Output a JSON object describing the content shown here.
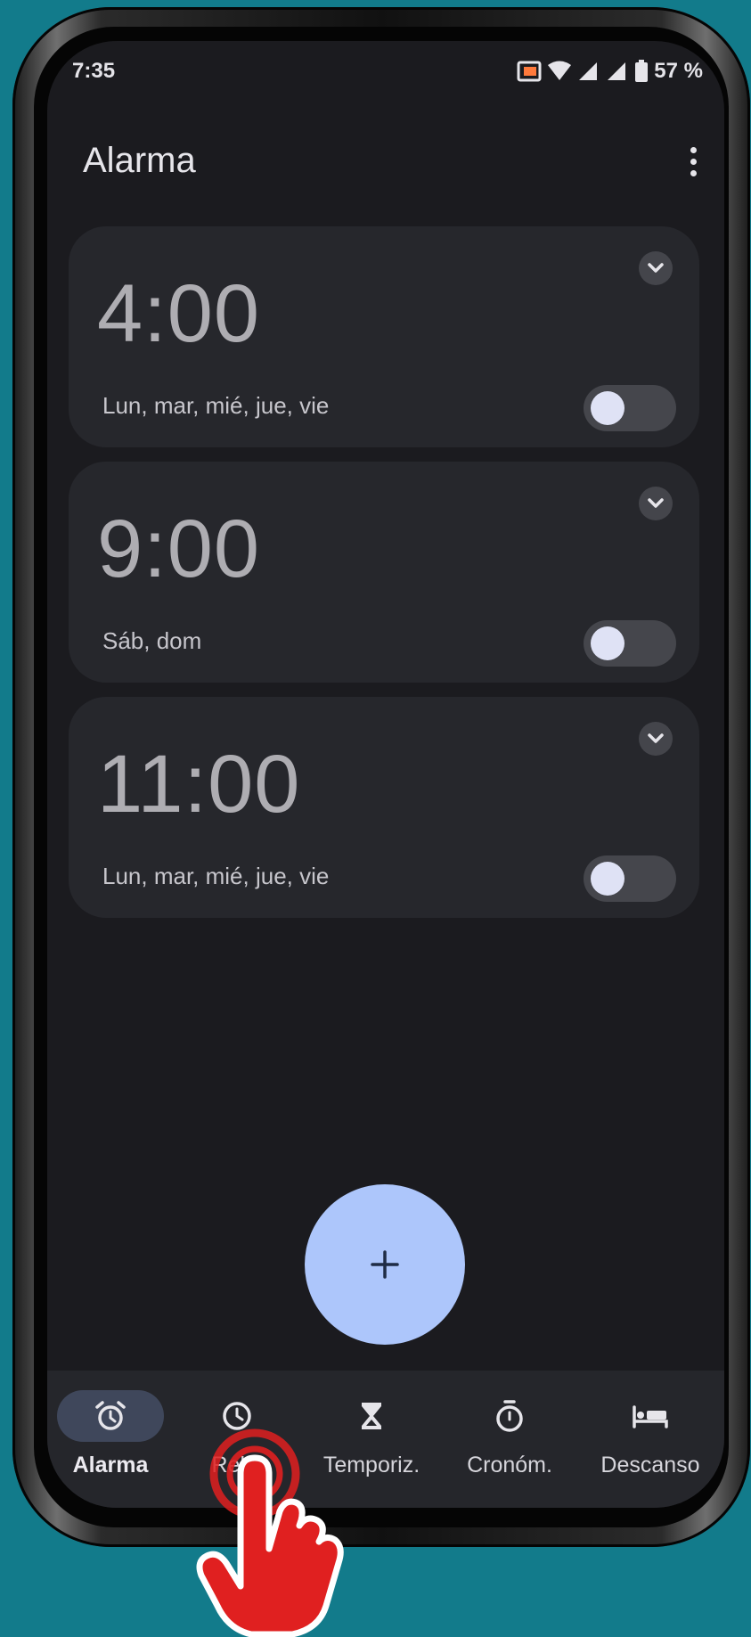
{
  "status_bar": {
    "time": "7:35",
    "battery": "57 %"
  },
  "header": {
    "title": "Alarma"
  },
  "alarms": [
    {
      "time": "4:00",
      "days": "Lun, mar, mié, jue, vie",
      "enabled": false
    },
    {
      "time": "9:00",
      "days": "Sáb, dom",
      "enabled": false
    },
    {
      "time": "11:00",
      "days": "Lun, mar, mié, jue, vie",
      "enabled": false
    }
  ],
  "fab": {
    "icon": "plus-icon",
    "symbol": "+"
  },
  "nav": [
    {
      "label": "Alarma",
      "icon": "alarm-clock-icon",
      "active": true
    },
    {
      "label": "Reloj",
      "icon": "clock-icon",
      "active": false
    },
    {
      "label": "Temporiz.",
      "icon": "hourglass-icon",
      "active": false
    },
    {
      "label": "Cronóm.",
      "icon": "stopwatch-icon",
      "active": false
    },
    {
      "label": "Descanso",
      "icon": "bed-icon",
      "active": false
    }
  ],
  "colors": {
    "accent": "#adc6fb",
    "background": "#1b1b1f",
    "card": "#26272c",
    "frame": "#127b8b",
    "pointer": "#e02020"
  }
}
